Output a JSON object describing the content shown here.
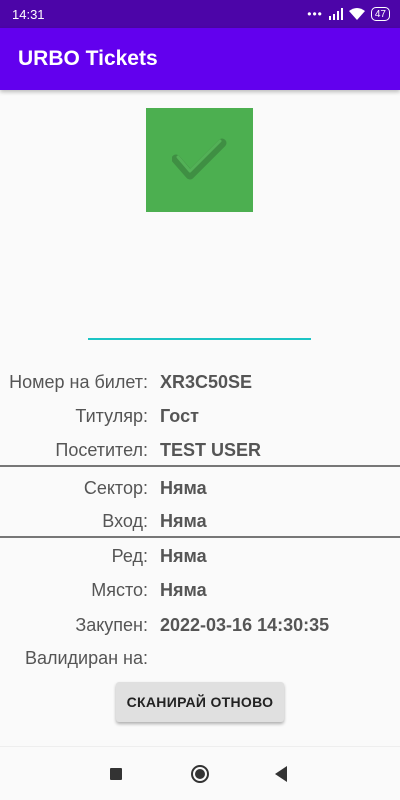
{
  "status_bar": {
    "time": "14:31",
    "dots": "•••",
    "battery": "47"
  },
  "app_bar": {
    "title": "URBO Tickets"
  },
  "ticket": {
    "number_label": "Номер на билет:",
    "number_value": "XR3C50SE",
    "holder_label": "Титуляр:",
    "holder_value": "Гост",
    "visitor_label": "Посетител:",
    "visitor_value": "TEST USER",
    "sector_label": "Сектор:",
    "sector_value": "Няма",
    "entrance_label": "Вход:",
    "entrance_value": "Няма",
    "row_label": "Ред:",
    "row_value": "Няма",
    "seat_label": "Място:",
    "seat_value": "Няма",
    "purchased_label": "Закупен:",
    "purchased_value": "2022-03-16 14:30:35",
    "validated_label": "Валидиран на:",
    "validated_value": ""
  },
  "actions": {
    "scan_again": "СКАНИРАЙ ОТНОВО"
  },
  "colors": {
    "status_bar": "#4c05a8",
    "app_bar": "#6200ee",
    "success": "#4caf50",
    "input_line": "#1cc4c4"
  },
  "icons": {
    "validation": "check-icon",
    "nav": [
      "recent-apps-icon",
      "home-icon",
      "back-icon"
    ]
  }
}
